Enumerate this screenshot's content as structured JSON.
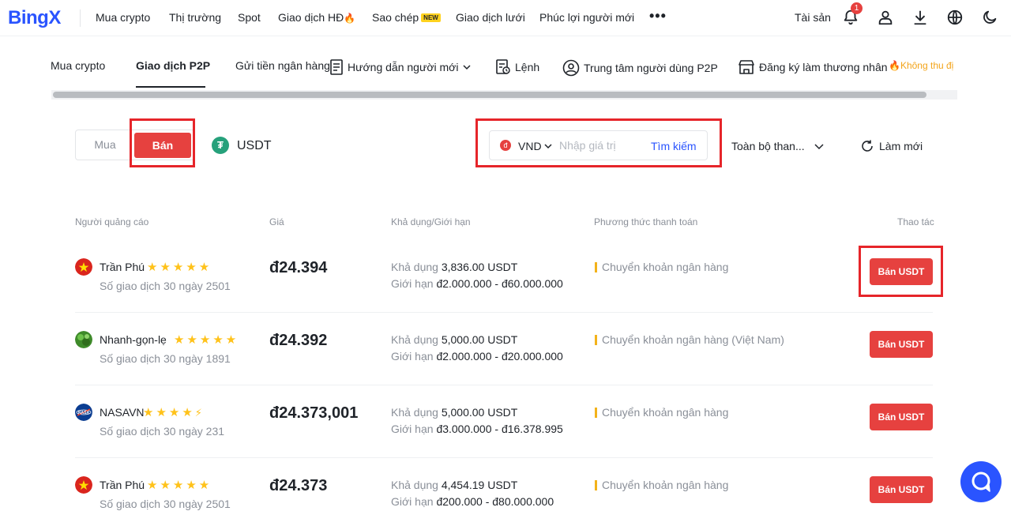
{
  "logo": "BingX",
  "topnav": {
    "items": [
      "Mua crypto",
      "Thị trường",
      "Spot",
      "Giao dịch HĐ",
      "Sao chép",
      "Giao dịch lưới",
      "Phúc lợi người mới"
    ],
    "new_badge": "NEW",
    "more": "•••",
    "assets": "Tài sản",
    "notification_count": "1"
  },
  "subnav": {
    "items": [
      "Mua crypto",
      "Giao dịch P2P",
      "Gửi tiền ngân hàng",
      "Hướng dẫn người mới",
      "Lệnh",
      "Trung tâm người dùng P2P",
      "Đăng ký làm thương nhân"
    ],
    "free_badge": "Không thu đị"
  },
  "filters": {
    "buy_label": "Mua",
    "sell_label": "Bán",
    "coin": "USDT",
    "currency": "VND",
    "amount_placeholder": "Nhập giá trị",
    "search_label": "Tìm kiếm",
    "payment_select": "Toàn bộ than...",
    "refresh_label": "Làm mới"
  },
  "table": {
    "headers": [
      "Người quảng cáo",
      "Giá",
      "Khả dụng/Giới hạn",
      "Phương thức thanh toán",
      "Thao tác"
    ],
    "avail_prefix": "Khả dụng",
    "limit_prefix": "Giới hạn",
    "rows": [
      {
        "name": "Trần Phú",
        "stars": "★★★★★",
        "trades": "Số giao dịch 30 ngày 2501",
        "price": "đ24.394",
        "available": "3,836.00 USDT",
        "limit": "đ2.000.000 - đ60.000.000",
        "payment": "Chuyển khoản ngân hàng",
        "action": "Bán USDT"
      },
      {
        "name": "Nhanh-gọn-lẹ",
        "stars": "★★★★★",
        "trades": "Số giao dịch 30 ngày 1891",
        "price": "đ24.392",
        "available": "5,000.00 USDT",
        "limit": "đ2.000.000 - đ20.000.000",
        "payment": "Chuyển khoản ngân hàng (Việt Nam)",
        "action": "Bán USDT"
      },
      {
        "name": "NASAVN",
        "stars": "★★★★",
        "trades": "Số giao dịch 30 ngày 231",
        "price": "đ24.373,001",
        "available": "5,000.00 USDT",
        "limit": "đ3.000.000 - đ16.378.995",
        "payment": "Chuyển khoản ngân hàng",
        "action": "Bán USDT"
      },
      {
        "name": "Trần Phú",
        "stars": "★★★★★",
        "trades": "Số giao dịch 30 ngày 2501",
        "price": "đ24.373",
        "available": "4,454.19 USDT",
        "limit": "đ200.000 - đ80.000.000",
        "payment": "Chuyển khoản ngân hàng",
        "action": "Bán USDT"
      }
    ]
  },
  "colors": {
    "brand": "#2a54ff",
    "sell": "#e6413f",
    "highlight": "#e6252a",
    "star": "#ffc21a"
  }
}
